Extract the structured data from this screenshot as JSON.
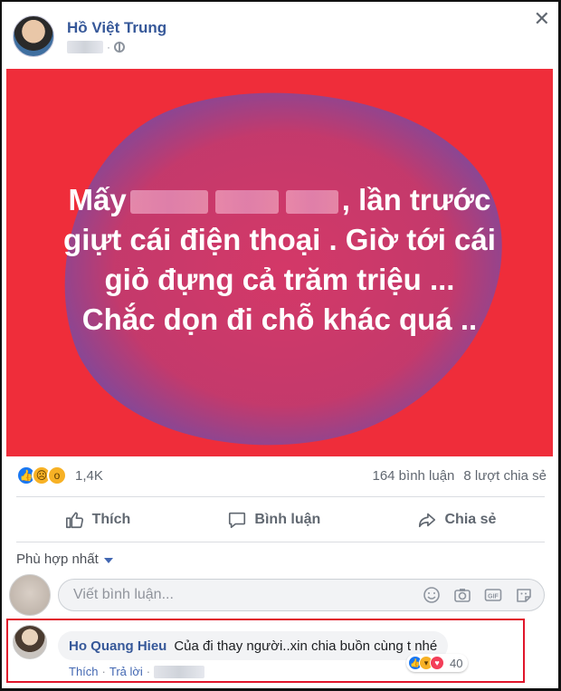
{
  "post": {
    "author": "Hồ Việt Trung",
    "text_parts": [
      "Mấy",
      ", lần trước",
      "giựt cái điện thoại . Giờ tới cái",
      "giỏ đựng cả trăm triệu ...",
      "Chắc dọn đi chỗ khác quá .."
    ],
    "background_color": "#ef2d3a"
  },
  "stats": {
    "reactions": [
      "like-icon",
      "sad-icon",
      "wow-icon"
    ],
    "reaction_count": "1,4K",
    "comments": "164 bình luận",
    "shares": "8 lượt chia sẻ"
  },
  "actions": {
    "like": "Thích",
    "comment": "Bình luận",
    "share": "Chia sẻ"
  },
  "comments_section": {
    "sort_label": "Phù hợp nhất",
    "input_placeholder": "Viết bình luận..."
  },
  "comment": {
    "author": "Ho Quang Hieu",
    "text": "Của đi thay người..xin chia buồn cùng t nhé",
    "reactions": [
      "like-icon",
      "haha-icon",
      "love-icon"
    ],
    "reaction_count": "40",
    "like_link": "Thích",
    "reply_link": "Trả lời"
  },
  "colors": {
    "accent": "#365899",
    "highlight": "#e0162b"
  }
}
